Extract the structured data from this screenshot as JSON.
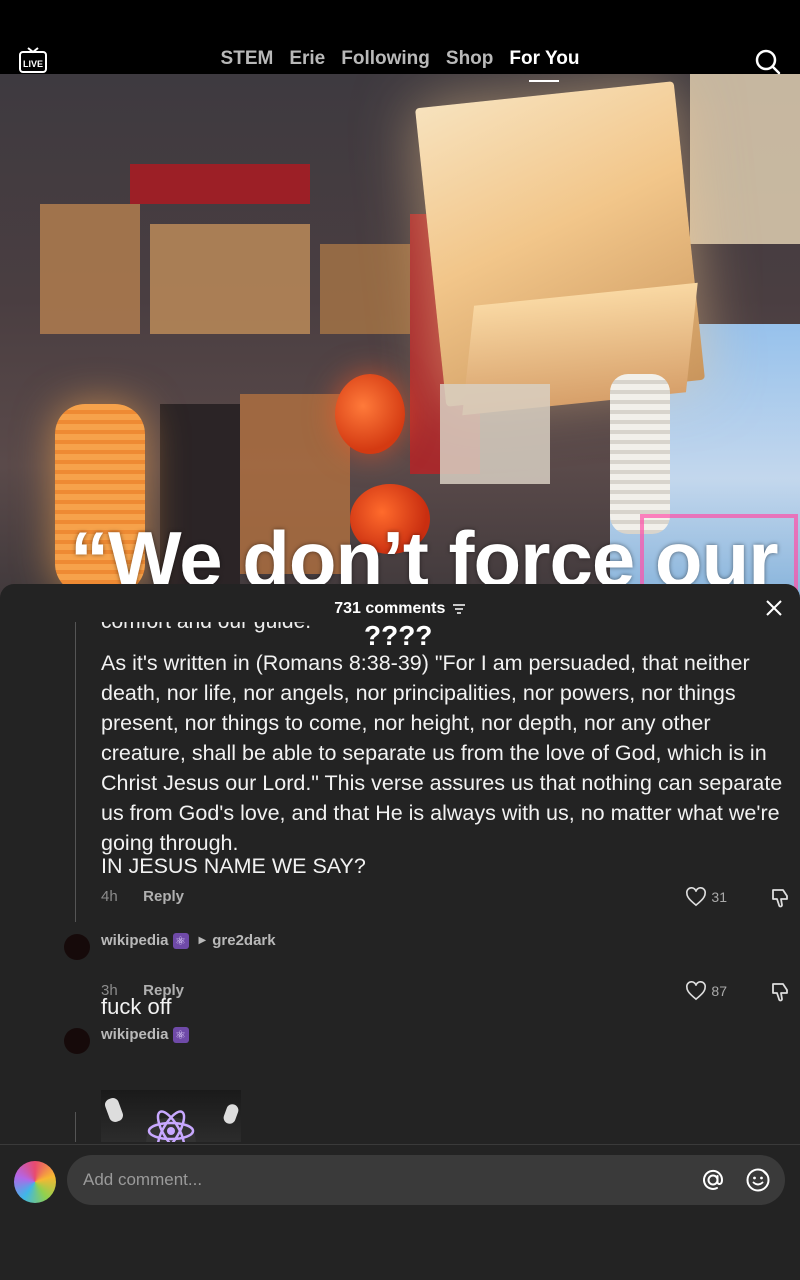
{
  "topbar": {
    "live_label": "LIVE",
    "tabs": [
      {
        "label": "STEM",
        "active": false
      },
      {
        "label": "Erie",
        "active": false
      },
      {
        "label": "Following",
        "active": false
      },
      {
        "label": "Shop",
        "active": false
      },
      {
        "label": "For You",
        "active": true
      }
    ]
  },
  "video": {
    "overlay_text": "“We don’t force our"
  },
  "comments": {
    "count_label": "731 comments",
    "clipped_line": "comfort and our guide.",
    "floating_marks": "????",
    "thread_comment": {
      "body": "As it's written in (Romans 8:38-39) \"For I am persuaded, that neither death, nor life, nor angels, nor principalities, nor powers, nor things present, nor things to come, nor height, nor depth, nor any other creature, shall be able to separate us from the love of God, which is in Christ Jesus our Lord.\" This verse assures us that nothing can separate us from God's love, and that He is always with us, no matter what we're going through.",
      "caps_line": "IN JESUS NAME WE SAY?",
      "time": "4h",
      "reply_label": "Reply",
      "likes": "31"
    },
    "reply_comment": {
      "username": "wikipedia",
      "badge": "⚛",
      "reply_to": "gre2dark",
      "text": "fuck off",
      "time": "3h",
      "reply_label": "Reply",
      "likes": "87"
    },
    "image_comment": {
      "username": "wikipedia",
      "badge": "⚛"
    }
  },
  "input": {
    "placeholder": "Add comment..."
  },
  "colors": {
    "sheet_bg": "#232323",
    "input_bg": "#3a3a3a",
    "badge_purple": "#6f4aa8"
  }
}
